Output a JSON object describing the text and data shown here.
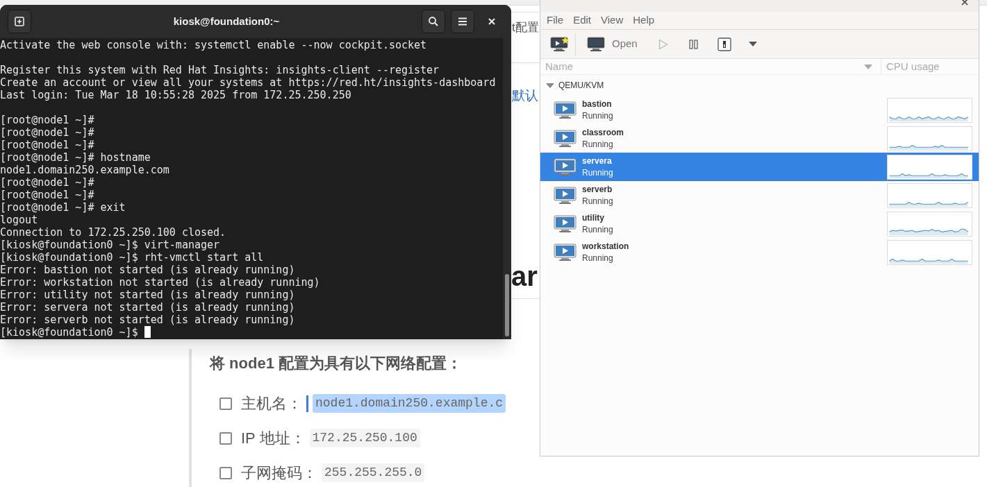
{
  "background_page": {
    "tab_label": "t配置",
    "link_fragment": "默认",
    "heading_fragment": "ar",
    "intro": "将 node1 配置为具有以下网络配置：",
    "checklist": [
      {
        "label": "主机名：",
        "value": "node1.domain250.example.c",
        "checked": false,
        "text_selected": true
      },
      {
        "label": "IP 地址：",
        "value": "172.25.250.100",
        "checked": false,
        "text_selected": false
      },
      {
        "label": "子网掩码：",
        "value": "255.255.255.0",
        "checked": false,
        "text_selected": false
      }
    ]
  },
  "terminal": {
    "title": "kiosk@foundation0:~",
    "cursor": true,
    "blocks": [
      [
        "Activate the web console with: systemctl enable --now cockpit.socket"
      ],
      [
        "Register this system with Red Hat Insights: insights-client --register",
        "Create an account or view all your systems at https://red.ht/insights-dashboard",
        "Last login: Tue Mar 18 10:55:28 2025 from 172.25.250.250"
      ],
      [
        "[root@node1 ~]#",
        "[root@node1 ~]#",
        "[root@node1 ~]#",
        "[root@node1 ~]# hostname",
        "node1.domain250.example.com",
        "[root@node1 ~]#",
        "[root@node1 ~]#",
        "[root@node1 ~]# exit",
        "logout",
        "Connection to 172.25.250.100 closed.",
        "[kiosk@foundation0 ~]$ virt-manager",
        "[kiosk@foundation0 ~]$ rht-vmctl start all",
        "Error: bastion not started (is already running)",
        "Error: workstation not started (is already running)",
        "Error: utility not started (is already running)",
        "Error: servera not started (is already running)",
        "Error: serverb not started (is already running)",
        "[kiosk@foundation0 ~]$ "
      ]
    ]
  },
  "vmm": {
    "menu": [
      "File",
      "Edit",
      "View",
      "Help"
    ],
    "toolbar": [
      {
        "kind": "new",
        "disabled": false
      },
      {
        "kind": "open",
        "label": "Open",
        "disabled": false
      },
      {
        "kind": "run",
        "disabled": true
      },
      {
        "kind": "pause",
        "disabled": false
      },
      {
        "kind": "shutdown",
        "disabled": false
      },
      {
        "kind": "dropdown",
        "disabled": false
      }
    ],
    "columns": [
      "Name",
      "CPU usage"
    ],
    "connection": {
      "label": "QEMU/KVM",
      "expanded": true
    },
    "vms": [
      {
        "name": "bastion",
        "status": "Running",
        "selected": false
      },
      {
        "name": "classroom",
        "status": "Running",
        "selected": false
      },
      {
        "name": "servera",
        "status": "Running",
        "selected": true
      },
      {
        "name": "serverb",
        "status": "Running",
        "selected": false
      },
      {
        "name": "utility",
        "status": "Running",
        "selected": false
      },
      {
        "name": "workstation",
        "status": "Running",
        "selected": false
      }
    ]
  }
}
